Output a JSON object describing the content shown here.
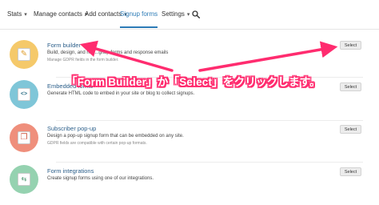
{
  "nav": {
    "items": [
      {
        "label": "Stats",
        "dropdown": true
      },
      {
        "label": "Manage contacts",
        "dropdown": true
      },
      {
        "label": "Add contacts",
        "dropdown": true
      },
      {
        "label": "Signup forms",
        "dropdown": false,
        "active": true
      },
      {
        "label": "Settings",
        "dropdown": true
      }
    ],
    "search_icon": "search-icon"
  },
  "rows": [
    {
      "title": "Form builder",
      "description": "Build, design, and h...           ...gnup forms and response emails",
      "note": "Manage GDPR fields in the form builder.",
      "button": "Select",
      "icon": "pencil-icon",
      "color": "#f5c96a"
    },
    {
      "title": "Embedded forms",
      "description": "Generate HTML code to embed in your site or blog to collect signups.",
      "note": "",
      "button": "Select",
      "icon": "code-icon",
      "color": "#7fc6d8"
    },
    {
      "title": "Subscriber pop-up",
      "description": "Design a pop-up signup form that can be embedded on any site.",
      "note": "GDPR fields are compatible with certain pop-up formats.",
      "button": "Select",
      "icon": "popup-icon",
      "color": "#ef8f7c"
    },
    {
      "title": "Form integrations",
      "description": "Create signup forms using one of our integrations.",
      "note": "",
      "button": "Select",
      "icon": "integration-icon",
      "color": "#95d2b0"
    }
  ],
  "annotation": {
    "text": "「Form Builder」か「Select」をクリックします。",
    "color": "#ff2c6f"
  }
}
